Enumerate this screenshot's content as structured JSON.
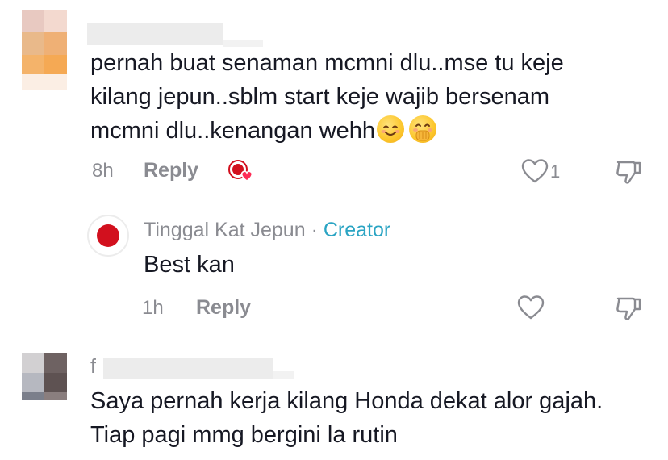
{
  "comments": [
    {
      "lines": [
        "pernah buat senaman mcmni dlu..mse tu keje",
        "kilang jepun..sblm start keje wajib bersenam",
        "mcmni dlu..kenangan wehh"
      ],
      "emojis": [
        "smiling-face-emoji",
        "face-with-hand-over-mouth-emoji"
      ],
      "time": "8h",
      "reply_label": "Reply",
      "like_count": "1"
    },
    {
      "author": "Tinggal Kat Jepun",
      "separator": "·",
      "badge": "Creator",
      "text": "Best kan",
      "time": "1h",
      "reply_label": "Reply"
    },
    {
      "author_initial": "f",
      "lines": [
        "Saya pernah kerja kilang Honda dekat alor gajah.",
        "Tiap pagi mmg bergini la rutin"
      ]
    }
  ],
  "colors": {
    "text": "#161823",
    "muted": "#8a8b91",
    "creator": "#2aa4c3",
    "avatar_red": "#d2101e"
  }
}
